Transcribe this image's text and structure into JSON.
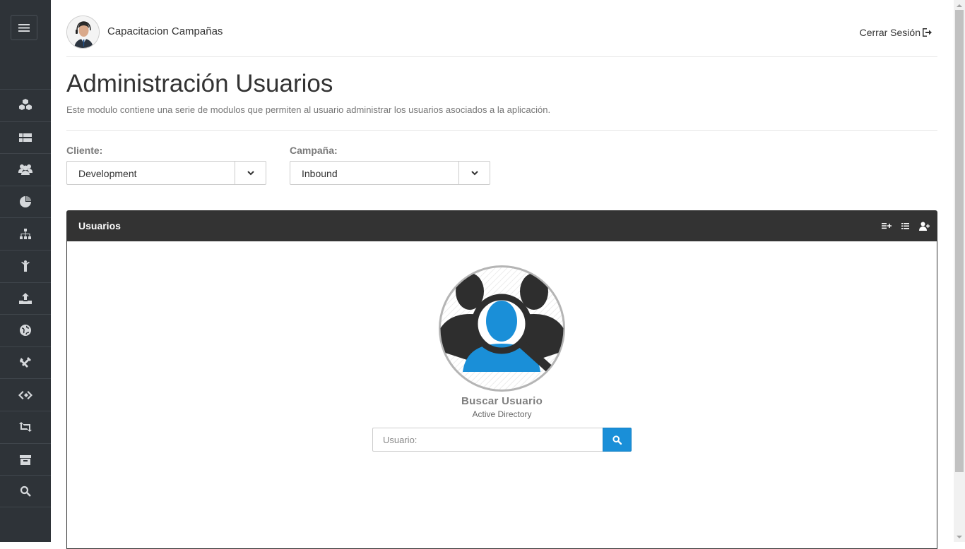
{
  "header": {
    "app_title": "Capacitacion Campañas",
    "logout_label": "Cerrar Sesión"
  },
  "page": {
    "title": "Administración Usuarios",
    "description": "Este modulo contiene una serie de modulos que permiten al usuario administrar los usuarios asociados a la aplicación."
  },
  "filters": {
    "cliente_label": "Cliente:",
    "cliente_value": "Development",
    "campana_label": "Campaña:",
    "campana_value": "Inbound"
  },
  "panel": {
    "title": "Usuarios",
    "tools": [
      "add-list-icon",
      "list-icon",
      "add-user-icon"
    ]
  },
  "search": {
    "title": "Buscar Usuario",
    "subtitle": "Active Directory",
    "placeholder": "Usuario:",
    "value": ""
  },
  "sidebar": {
    "items": [
      "cubes-icon",
      "grid-list-icon",
      "users-icon",
      "pie-chart-icon",
      "sitemap-icon",
      "person-icon",
      "upload-icon",
      "globe-icon",
      "tools-icon",
      "code-icon",
      "retweet-icon",
      "archive-icon",
      "search-icon"
    ]
  },
  "colors": {
    "sidebar": "#2e3338",
    "panel_header": "#333333",
    "accent": "#1a8fd8"
  }
}
